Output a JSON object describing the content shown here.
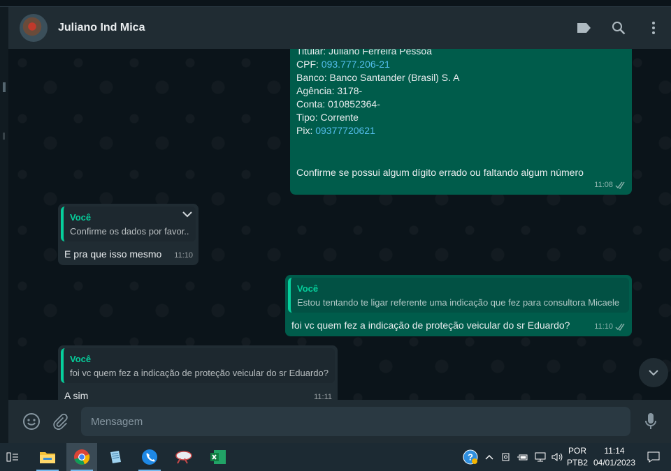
{
  "header": {
    "contact_name": "Juliano Ind Mica",
    "icons": [
      "label-icon",
      "search-icon",
      "menu-icon"
    ]
  },
  "messages": {
    "bank_details": {
      "lines": [
        {
          "label": "Titular: Juliano Ferreira Pessoa",
          "link": ""
        },
        {
          "label": "CPF: ",
          "link": "093.777.206-21"
        },
        {
          "label": "Banco: Banco Santander (Brasil) S. A",
          "link": ""
        },
        {
          "label": "Agência: 3178-",
          "link": ""
        },
        {
          "label": "Conta: 010852364-",
          "link": ""
        },
        {
          "label": "Tipo: Corrente",
          "link": ""
        },
        {
          "label": "Pix: ",
          "link": "09377720621"
        }
      ],
      "footer": "Confirme se possui algum dígito errado ou faltando algum número",
      "time": "11:08"
    },
    "reply_1": {
      "quote_author": "Você",
      "quote_text": "Confirme os dados por favor..",
      "text": "E pra que isso mesmo",
      "time": "11:10"
    },
    "reply_2": {
      "quote_author": "Você",
      "quote_text": "Estou tentando te ligar referente uma indicação que fez para consultora Micaele",
      "text": "foi vc quem fez a indicação de proteção veicular do sr Eduardo?",
      "time": "11:10"
    },
    "reply_3": {
      "quote_author": "Você",
      "quote_text": "foi vc quem fez a indicação de proteção veicular do sr Eduardo?",
      "text": "A sim",
      "time": "11:11"
    }
  },
  "compose": {
    "placeholder": "Mensagem"
  },
  "taskbar": {
    "language": "POR",
    "layout": "PTB2",
    "time": "11:14",
    "date": "04/01/2023"
  },
  "colors": {
    "outgoing_bubble": "#005c4b",
    "incoming_bubble": "#202c33",
    "accent": "#06cf9c",
    "link": "#53bdeb"
  }
}
